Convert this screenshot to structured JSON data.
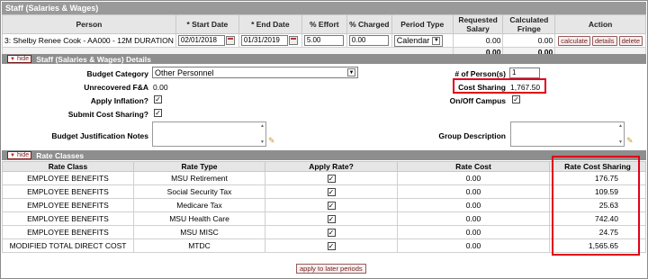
{
  "staff_section": {
    "title": "Staff (Salaries & Wages)",
    "columns": [
      "Person",
      "* Start Date",
      "* End Date",
      "% Effort",
      "% Charged",
      "Period Type",
      "Requested Salary",
      "Calculated Fringe",
      "Action"
    ],
    "row": {
      "person": "3: Shelby Renee Cook - AA000 - 12M DURATION",
      "start_date": "02/01/2018",
      "end_date": "01/31/2019",
      "effort": "5.00",
      "charged": "0.00",
      "period_type": "Calendar",
      "requested_salary": "0.00",
      "calculated_fringe": "0.00",
      "actions": [
        "calculate",
        "details",
        "delete"
      ]
    },
    "totals": {
      "requested_salary": "0.00",
      "calculated_fringe": "0.00"
    }
  },
  "details_section": {
    "hide_label": "hide",
    "title": "Staff (Salaries & Wages) Details",
    "budget_category_label": "Budget Category",
    "budget_category_value": "Other Personnel",
    "num_persons_label": "# of Person(s)",
    "num_persons_value": "1",
    "unrecovered_fa_label": "Unrecovered F&A",
    "unrecovered_fa_value": "0.00",
    "cost_sharing_label": "Cost Sharing",
    "cost_sharing_value": "1,767.50",
    "apply_inflation_label": "Apply Inflation?",
    "on_off_campus_label": "On/Off Campus",
    "submit_cost_sharing_label": "Submit Cost Sharing?",
    "budget_justification_label": "Budget Justification Notes",
    "group_description_label": "Group Description"
  },
  "rate_section": {
    "hide_label": "hide",
    "title": "Rate Classes",
    "columns": [
      "Rate Class",
      "Rate Type",
      "Apply Rate?",
      "Rate Cost",
      "Rate Cost Sharing"
    ],
    "rows": [
      {
        "rate_class": "EMPLOYEE BENEFITS",
        "rate_type": "MSU Retirement",
        "apply": true,
        "rate_cost": "0.00",
        "rate_cost_sharing": "176.75"
      },
      {
        "rate_class": "EMPLOYEE BENEFITS",
        "rate_type": "Social Security Tax",
        "apply": true,
        "rate_cost": "0.00",
        "rate_cost_sharing": "109.59"
      },
      {
        "rate_class": "EMPLOYEE BENEFITS",
        "rate_type": "Medicare Tax",
        "apply": true,
        "rate_cost": "0.00",
        "rate_cost_sharing": "25.63"
      },
      {
        "rate_class": "EMPLOYEE BENEFITS",
        "rate_type": "MSU Health Care",
        "apply": true,
        "rate_cost": "0.00",
        "rate_cost_sharing": "742.40"
      },
      {
        "rate_class": "EMPLOYEE BENEFITS",
        "rate_type": "MSU MISC",
        "apply": true,
        "rate_cost": "0.00",
        "rate_cost_sharing": "24.75"
      },
      {
        "rate_class": "MODIFIED TOTAL DIRECT COST",
        "rate_type": "MTDC",
        "apply": true,
        "rate_cost": "0.00",
        "rate_cost_sharing": "1,565.65"
      }
    ],
    "apply_later_label": "apply to later periods"
  },
  "colors": {
    "highlight": "#e0001a",
    "section_bar": "#8e8e8e",
    "button_text": "#7a1b1b"
  },
  "icons": [
    "calendar-icon",
    "dropdown-arrow-icon",
    "checkbox-checked-icon",
    "pencil-icon",
    "collapse-triangle-icon"
  ]
}
